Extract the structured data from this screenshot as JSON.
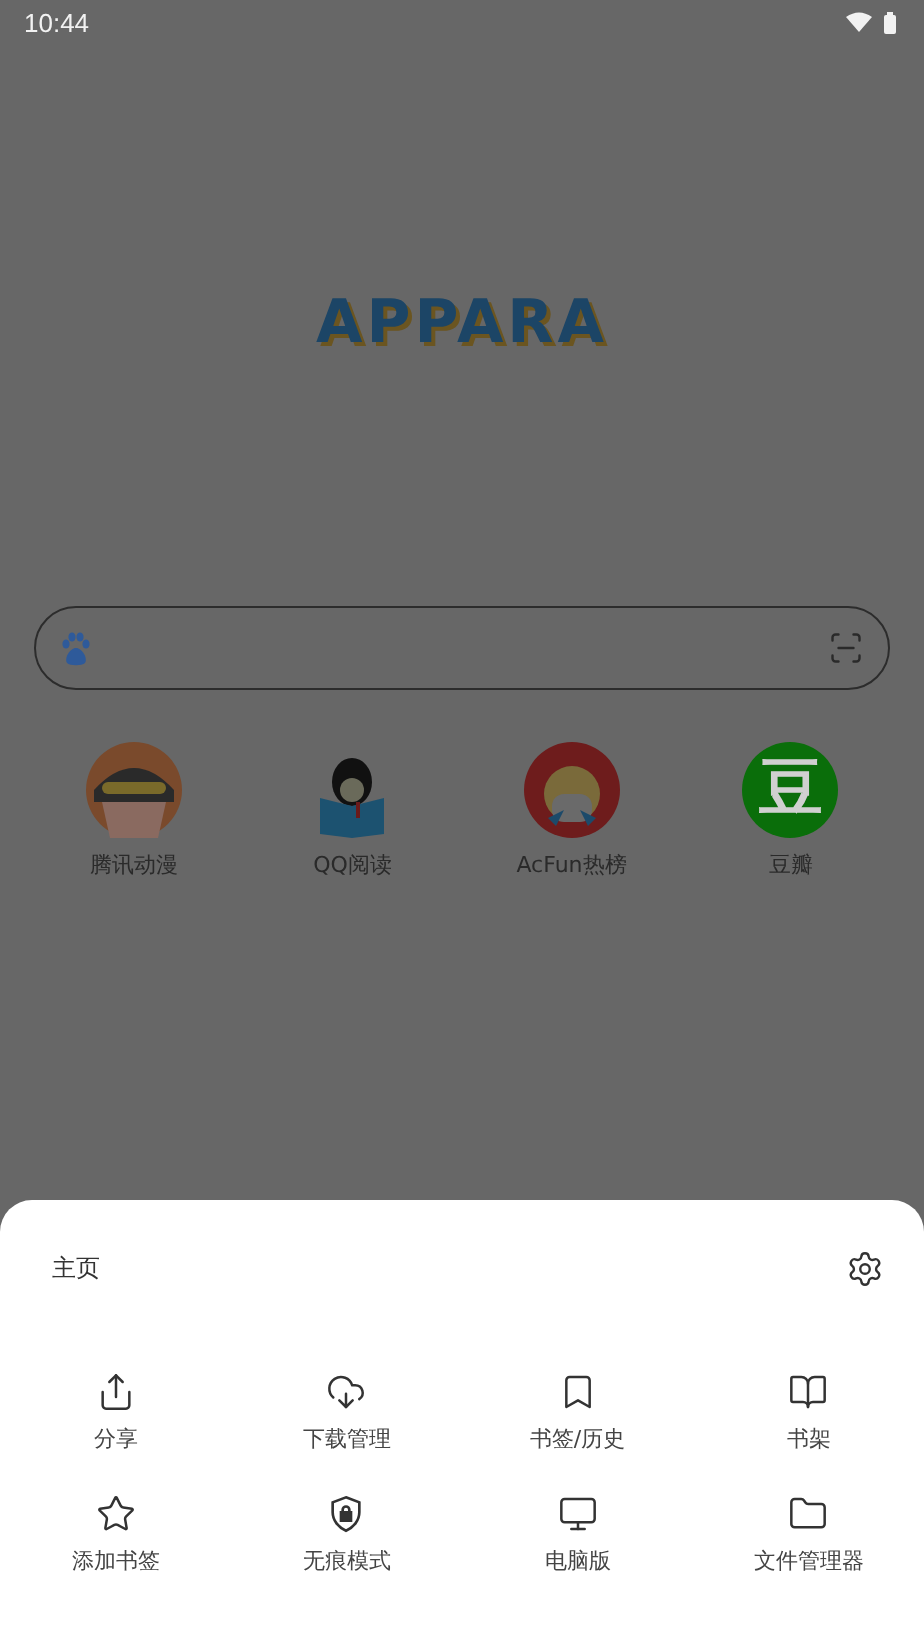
{
  "status_bar": {
    "time": "10:44"
  },
  "logo": {
    "text": "APPARA"
  },
  "shortcuts": [
    {
      "label": "腾讯动漫",
      "kind": "goggles"
    },
    {
      "label": "QQ阅读",
      "kind": "penguin"
    },
    {
      "label": "AcFun热榜",
      "kind": "girl"
    },
    {
      "label": "豆瓣",
      "kind": "glyph",
      "glyph": "豆"
    }
  ],
  "menu": {
    "title": "主页",
    "items": [
      {
        "label": "分享"
      },
      {
        "label": "下载管理"
      },
      {
        "label": "书签/历史"
      },
      {
        "label": "书架"
      },
      {
        "label": "添加书签"
      },
      {
        "label": "无痕模式"
      },
      {
        "label": "电脑版"
      },
      {
        "label": "文件管理器"
      }
    ]
  }
}
